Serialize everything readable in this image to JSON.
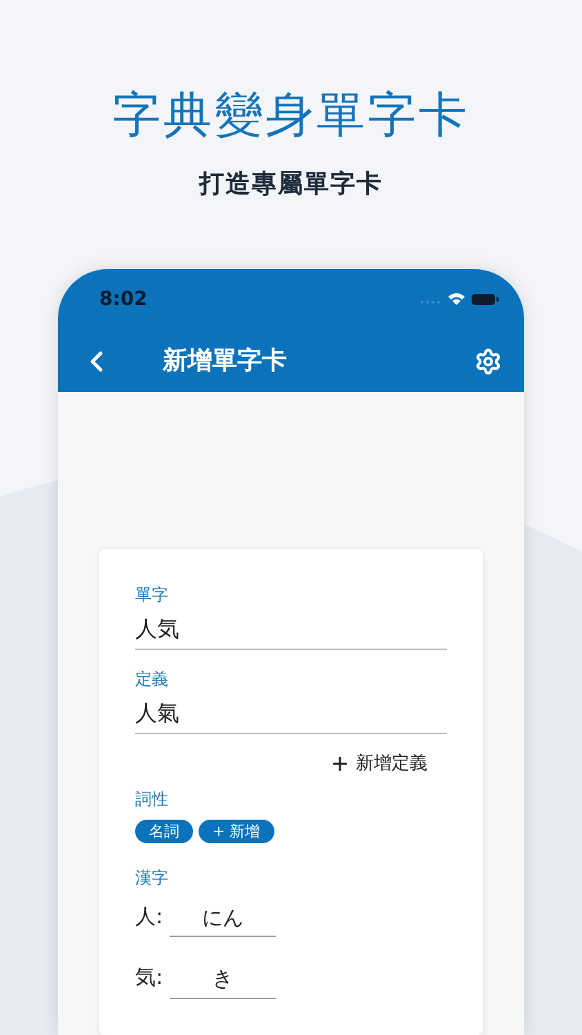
{
  "headline": "字典變身單字卡",
  "subtitle": "打造專屬單字卡",
  "status_bar": {
    "time": "8:02"
  },
  "nav": {
    "title": "新增單字卡"
  },
  "fields": [
    {
      "label": "單字",
      "value": "人気"
    },
    {
      "label": "定義",
      "value": "人氣"
    }
  ],
  "add_definition": "新增定義",
  "part_of_speech": {
    "label": "詞性",
    "tags": [
      {
        "label": "名詞"
      },
      {
        "label": "+ 新增"
      }
    ]
  },
  "kanji": {
    "label": "漢字",
    "readings": [
      {
        "char": "人:",
        "reading": "にん"
      },
      {
        "char": "気:",
        "reading": "き"
      }
    ]
  }
}
